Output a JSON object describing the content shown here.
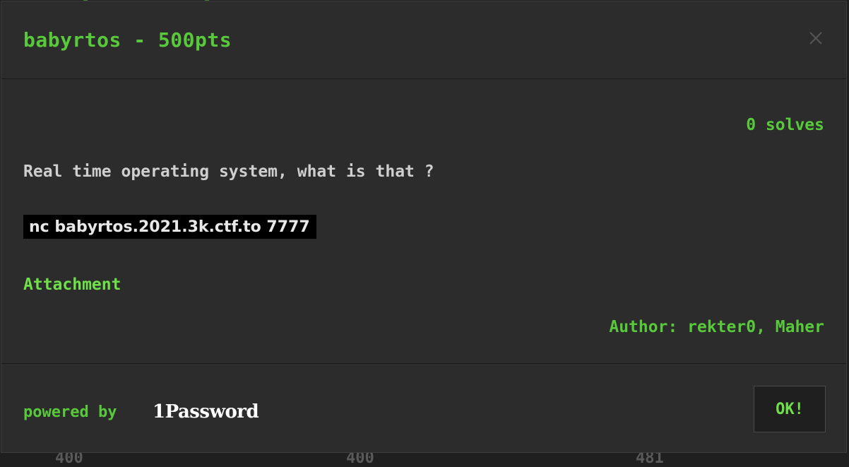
{
  "modal": {
    "title": "babyrtos - 500pts",
    "close_icon": "close-icon",
    "solves": "0 solves",
    "description": "Real time operating system, what is that ?",
    "connection": "nc babyrtos.2021.3k.ctf.to 7777",
    "attachment_label": "Attachment",
    "author": "Author: rekter0, Maher",
    "footer": {
      "powered_by": "powered by",
      "sponsor_logo": "1Password",
      "ok_label": "OK!"
    }
  },
  "background": {
    "partial_numbers": [
      "400",
      "400",
      "481"
    ]
  },
  "colors": {
    "accent_green": "#59c93c",
    "link_green": "#6fe04a",
    "modal_bg": "#2c2c2c",
    "text_light": "#cfcfcf"
  }
}
